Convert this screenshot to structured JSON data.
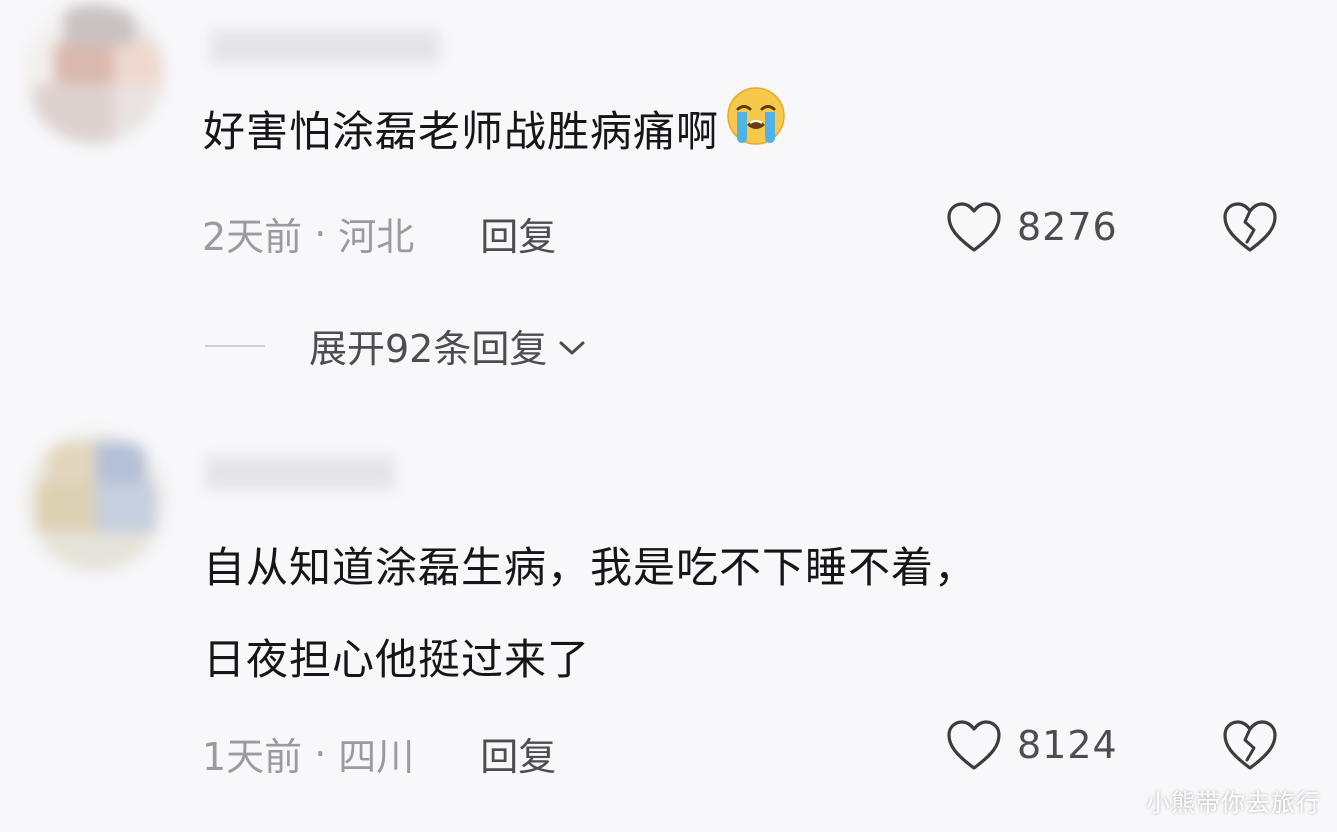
{
  "comments": [
    {
      "text": "好害怕涂磊老师战胜病痛啊",
      "emoji": "loudly-crying-face",
      "time": "2天前",
      "separator": "·",
      "location": "河北",
      "reply_label": "回复",
      "like_count": "8276",
      "expand_replies": "展开92条回复"
    },
    {
      "text_lines": [
        "自从知道涂磊生病，我是吃不下睡不着，",
        "日夜担心他挺过来了"
      ],
      "time": "1天前",
      "separator": "·",
      "location": "四川",
      "reply_label": "回复",
      "like_count": "8124"
    }
  ],
  "icons": {
    "like": "heart-outline-icon",
    "dislike": "broken-heart-icon",
    "expand": "chevron-down-icon"
  },
  "watermark": "小熊带你去旅行"
}
